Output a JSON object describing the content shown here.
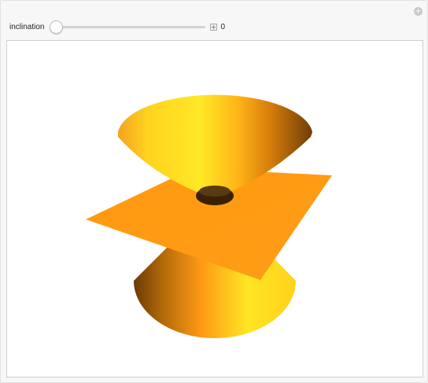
{
  "controls": {
    "slider_label": "inclination",
    "slider_value": "0",
    "slider_fraction": 0
  },
  "icons": {
    "corner": "plus-circle-icon",
    "expand": "plus-square-icon"
  },
  "colors": {
    "orange": "#ff9b12",
    "yellow": "#ffe522",
    "brown": "#6a3a06",
    "panel": "#f7f7f7"
  }
}
